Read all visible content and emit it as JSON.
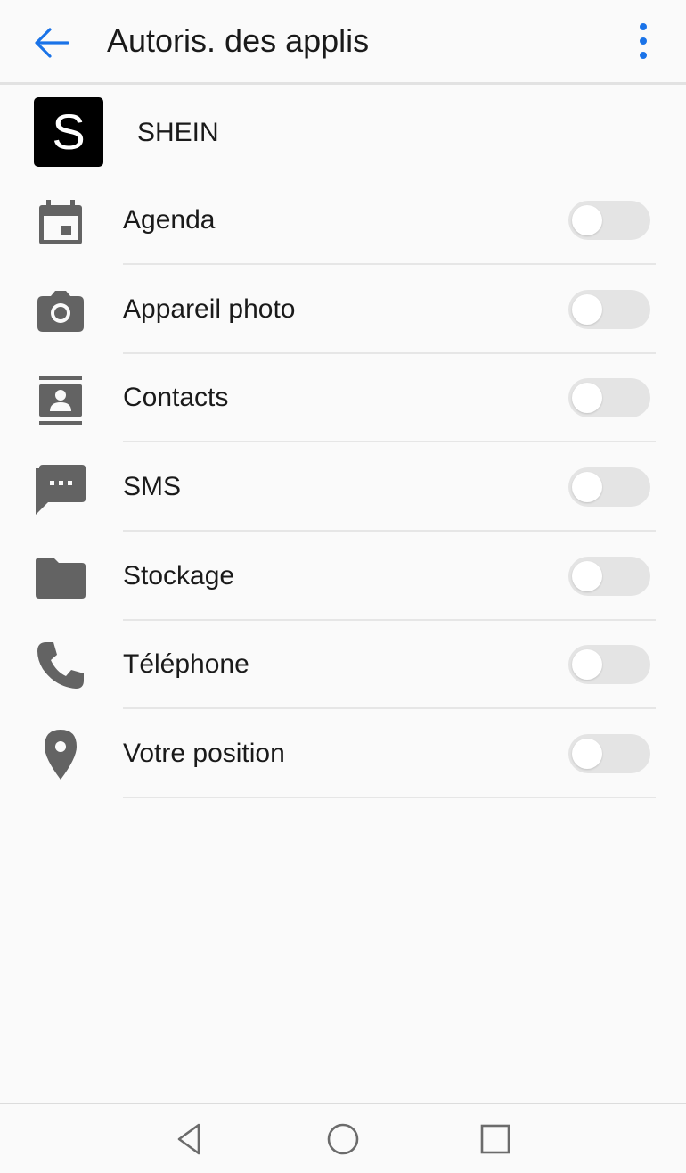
{
  "header": {
    "title": "Autoris. des applis",
    "back_icon": "arrow-left-icon",
    "menu_icon": "more-vert-icon"
  },
  "app": {
    "logo_letter": "S",
    "name": "SHEIN"
  },
  "permissions": [
    {
      "label": "Agenda",
      "icon": "calendar-icon",
      "enabled": false
    },
    {
      "label": "Appareil photo",
      "icon": "camera-icon",
      "enabled": false
    },
    {
      "label": "Contacts",
      "icon": "contacts-icon",
      "enabled": false
    },
    {
      "label": "SMS",
      "icon": "sms-icon",
      "enabled": false
    },
    {
      "label": "Stockage",
      "icon": "folder-icon",
      "enabled": false
    },
    {
      "label": "Téléphone",
      "icon": "phone-icon",
      "enabled": false
    },
    {
      "label": "Votre position",
      "icon": "location-icon",
      "enabled": false
    }
  ],
  "navbar": {
    "back_icon": "nav-back-icon",
    "home_icon": "nav-home-icon",
    "recents_icon": "nav-recents-icon"
  },
  "colors": {
    "accent": "#1a73e8",
    "icon_gray": "#636363",
    "toggle_off": "#e4e4e4",
    "background": "#fafafa"
  }
}
